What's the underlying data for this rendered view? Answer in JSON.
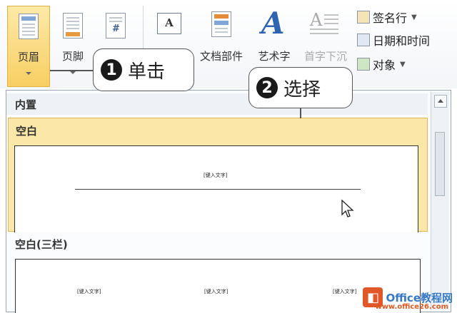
{
  "ribbon": {
    "header_label": "页眉",
    "footer_label": "页脚",
    "page_number_label": "",
    "textbox_label": "",
    "doc_parts_label": "文档部件",
    "wordart_label": "艺术字",
    "dropcap_label": "首字下沉",
    "signature_line_label": "签名行",
    "date_time_label": "日期和时间",
    "object_label": "对象"
  },
  "callouts": {
    "step1_num": "1",
    "step1_text": "单击",
    "step2_num": "2",
    "step2_text": "选择"
  },
  "gallery": {
    "section_label": "内置",
    "item1_title": "空白",
    "item1_placeholder": "[键入文字]",
    "item2_title": "空白(三栏)",
    "item2_placeholder_left": "[键入文字]",
    "item2_placeholder_center": "[键入文字]",
    "item2_placeholder_right": "[键入文字]"
  },
  "watermark": {
    "text": "Office教程网",
    "sub": "www.office26.com"
  },
  "colors": {
    "selected_bg": "#fbe7a8",
    "header_btn_bg": "#f8cf62",
    "logo": "#e0572a"
  },
  "icons": [
    "header-doc-icon",
    "footer-doc-icon",
    "page-number-icon",
    "textbox-icon",
    "doc-parts-icon",
    "wordart-icon",
    "dropcap-icon",
    "signature-icon",
    "calendar-icon",
    "object-icon",
    "cursor-icon",
    "scroll-up-icon"
  ]
}
